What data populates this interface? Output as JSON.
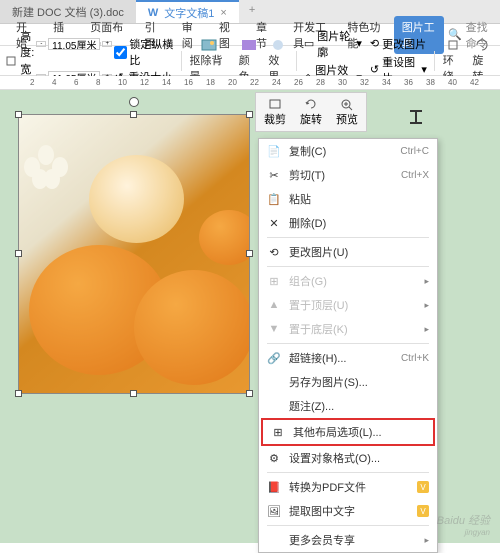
{
  "tabs": {
    "inactive": "新建 DOC 文档 (3).doc",
    "active": "文字文稿1"
  },
  "ribbon": {
    "start": "开始",
    "insert": "插入",
    "layout": "页面布局",
    "ref": "引用",
    "review": "审阅",
    "view": "视图",
    "chapter": "章节",
    "devtools": "开发工具",
    "special": "特色功能",
    "pictools": "图片工具",
    "search_ph": "查找命令"
  },
  "toolbar": {
    "height_label": "高度:",
    "height_val": "11.05厘米",
    "width_label": "宽度:",
    "width_val": "11.05厘米",
    "lock": "锁定纵横比",
    "reset": "重设大小",
    "rmbg": "抠除背景",
    "color": "颜色",
    "effects": "效果",
    "outline": "图片轮廓",
    "effect2": "图片效果",
    "change": "更改图片",
    "resetpic": "重设图片",
    "wrap": "环绕",
    "rotate": "旋转"
  },
  "ruler_marks": [
    "2",
    "4",
    "6",
    "8",
    "10",
    "12",
    "14",
    "16",
    "18",
    "20",
    "22",
    "24",
    "26",
    "28",
    "30",
    "32",
    "34",
    "36",
    "38",
    "40",
    "42"
  ],
  "float_toolbar": {
    "crop": "裁剪",
    "rotate": "旋转",
    "preview": "预览"
  },
  "context_menu": {
    "copy": "复制(C)",
    "copy_sc": "Ctrl+C",
    "cut": "剪切(T)",
    "cut_sc": "Ctrl+X",
    "paste": "粘贴",
    "delete": "删除(D)",
    "change_pic": "更改图片(U)",
    "group": "组合(G)",
    "bring_top": "置于顶层(U)",
    "send_back": "置于底层(K)",
    "hyperlink": "超链接(H)...",
    "hyperlink_sc": "Ctrl+K",
    "save_as": "另存为图片(S)...",
    "caption": "题注(Z)...",
    "other_layout": "其他布局选项(L)...",
    "format_obj": "设置对象格式(O)...",
    "to_pdf": "转换为PDF文件",
    "extract_text": "提取图中文字",
    "more_vip": "更多会员专享"
  },
  "watermark": {
    "main": "Baidu 经验",
    "sub": "jingyan"
  }
}
